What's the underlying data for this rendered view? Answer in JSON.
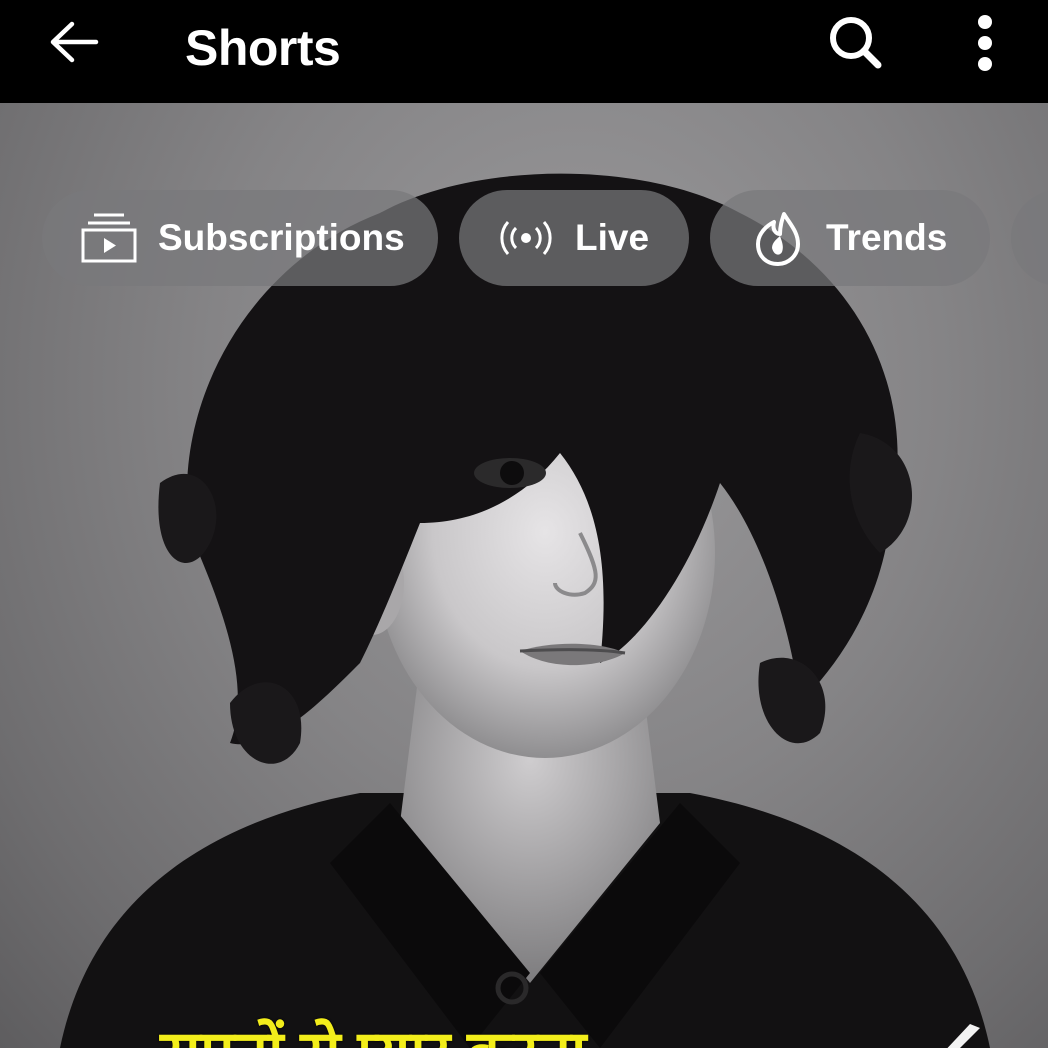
{
  "header": {
    "title": "Shorts",
    "back_icon": "arrow-left-icon",
    "search_icon": "search-icon",
    "more_icon": "more-vertical-icon"
  },
  "chips": [
    {
      "label": "Subscriptions",
      "icon": "subscriptions-icon"
    },
    {
      "label": "Live",
      "icon": "live-broadcast-icon"
    },
    {
      "label": "Trends",
      "icon": "trends-flame-icon"
    },
    {
      "label": "",
      "icon": ""
    }
  ],
  "video": {
    "caption": "सपनों से प्यार करना",
    "caption_color": "#f3ee1b"
  },
  "colors": {
    "topbar_bg": "#000000",
    "chip_bg": "rgba(120,120,124,0.72)",
    "text": "#ffffff"
  }
}
